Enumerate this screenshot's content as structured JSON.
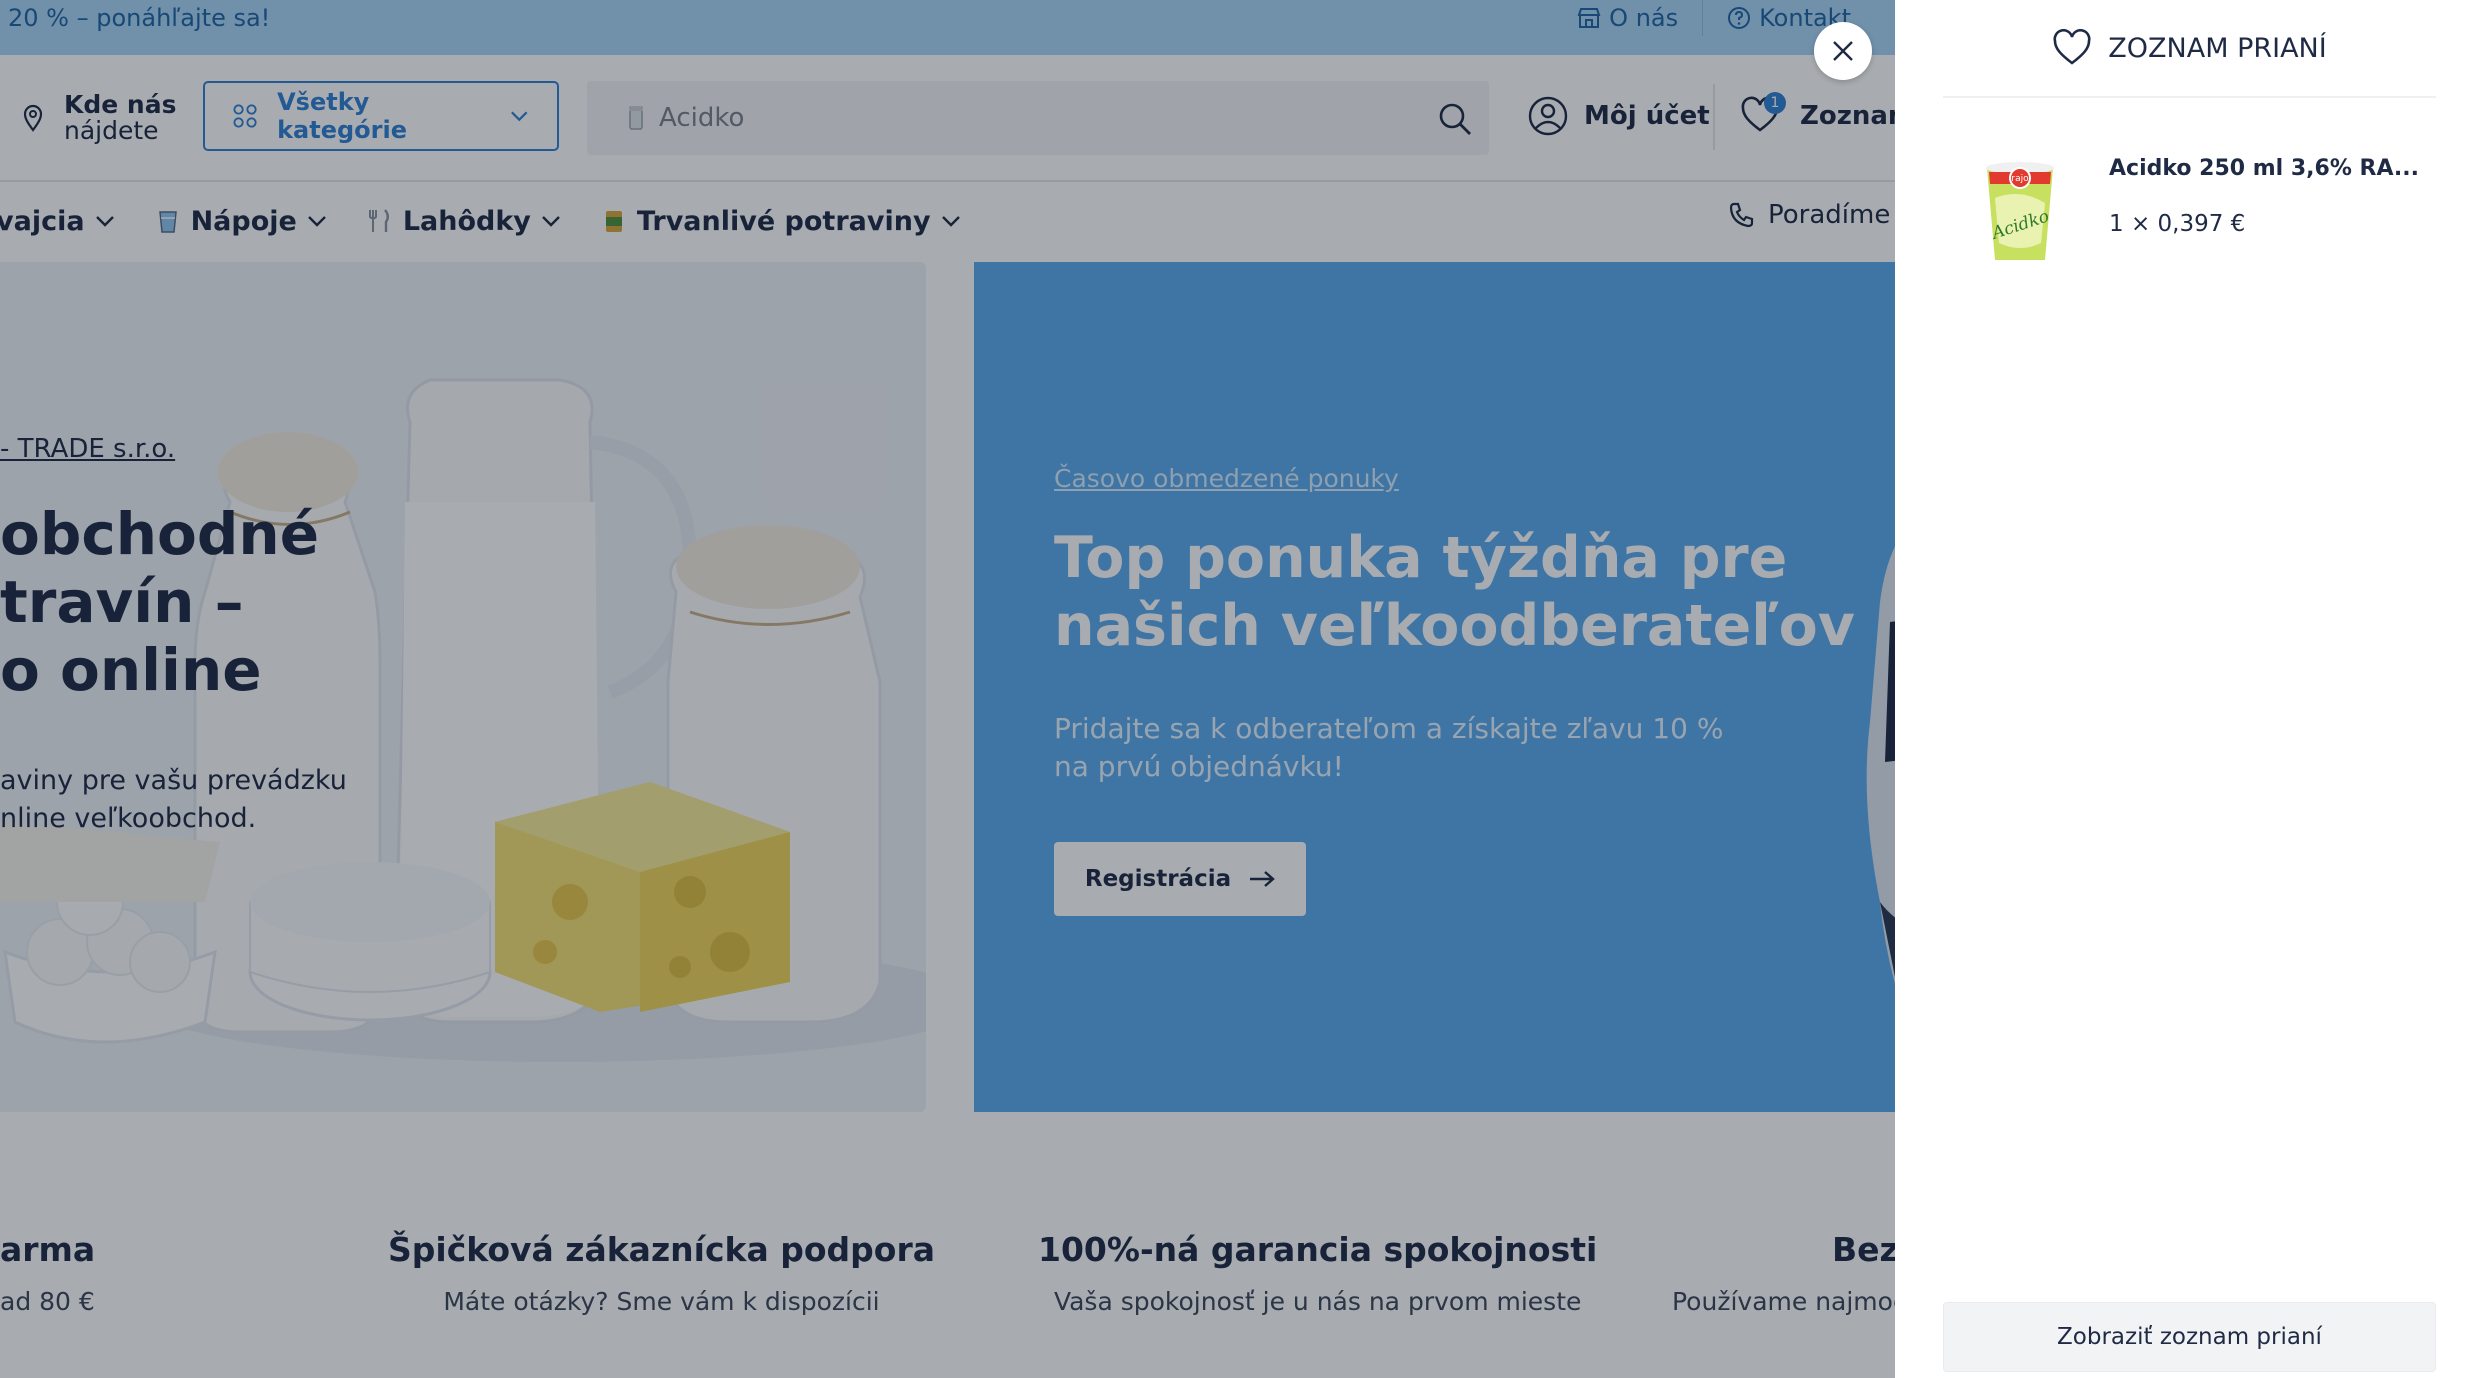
{
  "promo": {
    "text": "20 % – ponáhľajte sa!"
  },
  "top_links": {
    "about": "O nás",
    "contact": "Kontakt"
  },
  "header": {
    "location_line1": "Kde nás",
    "location_line2": "nájdete",
    "categories_button": "Všetky kategórie",
    "search_value": "Acidko",
    "account": "Môj účet",
    "wishlist_label": "Zoznam",
    "wishlist_count": "1"
  },
  "nav": {
    "items": [
      {
        "label": "vajcia"
      },
      {
        "label": "Nápoje"
      },
      {
        "label": "Lahôdky"
      },
      {
        "label": "Trvanlivé potraviny"
      }
    ],
    "advice": "Poradíme V"
  },
  "hero_left": {
    "company": "- TRADE s.r.o.",
    "heading": "obchodné\ntravín –\no online",
    "description": "aviny pre vašu prevádzku\nnline veľkoobchod."
  },
  "hero_right": {
    "tag": "Časovo obmedzené ponuky",
    "heading": "Top ponuka týždňa pre\nnašich veľkoodberateľov",
    "subtext": "Pridajte sa k odberateľom a získajte zľavu 10 %\nna prvú objednávku!",
    "button": "Registrácia"
  },
  "benefits": [
    {
      "title": "arma",
      "subtitle": "ad 80 €"
    },
    {
      "title": "Špičková zákaznícka podpora",
      "subtitle": "Máte otázky? Sme vám k dispozícii"
    },
    {
      "title": "100%-ná garancia spokojnosti",
      "subtitle": "Vaša spokojnosť je u nás na prvom mieste"
    },
    {
      "title": "Bezp",
      "subtitle": "Používame najmod"
    }
  ],
  "drawer": {
    "title": "ZOZNAM PRIANÍ",
    "item_name": "Acidko 250 ml 3,6% RA...",
    "item_qty": "1 × 0,397 €",
    "view_button": "Zobraziť zoznam prianí",
    "product_brand": "rajo",
    "product_script": "Acidko"
  },
  "colors": {
    "accent": "#2f7fd0",
    "hero_blue": "#5aa9ec",
    "overlay": "rgba(15,24,38,0.36)"
  }
}
